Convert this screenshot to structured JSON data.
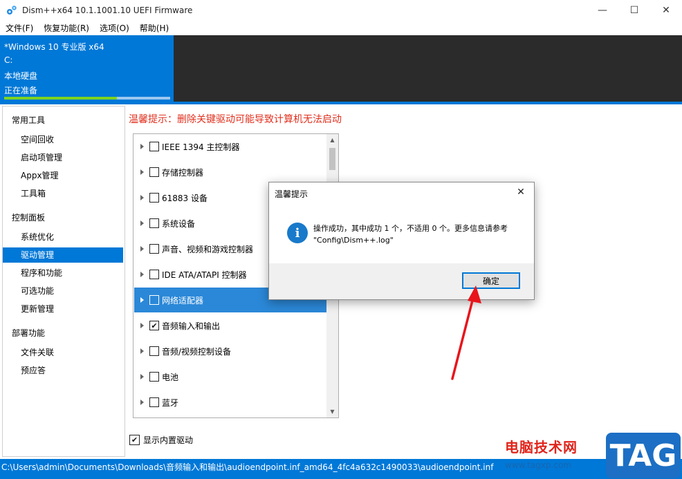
{
  "window": {
    "title": "Dism++x64 10.1.1001.10 UEFI Firmware",
    "minimize_glyph": "—",
    "maximize_glyph": "☐",
    "close_glyph": "✕"
  },
  "menu": [
    {
      "label": "文件(F)"
    },
    {
      "label": "恢复功能(R)"
    },
    {
      "label": "选项(O)"
    },
    {
      "label": "帮助(H)"
    }
  ],
  "header": {
    "os_name": "*Windows 10 专业版 x64",
    "drive": "C:",
    "disk_type": "本地硬盘",
    "status": "正在准备",
    "progress": 0.68,
    "colors": {
      "accent": "#0078d7",
      "progress": "#7ed321",
      "dark": "#2b2b2b"
    }
  },
  "sidebar": {
    "groups": [
      {
        "title": "常用工具",
        "items": [
          "空间回收",
          "启动项管理",
          "Appx管理",
          "工具箱"
        ]
      },
      {
        "title": "控制面板",
        "items": [
          "系统优化",
          "驱动管理",
          "程序和功能",
          "可选功能",
          "更新管理"
        ]
      },
      {
        "title": "部署功能",
        "items": [
          "文件关联",
          "预应答"
        ]
      }
    ],
    "selected": "驱动管理"
  },
  "main": {
    "warning": "温馨提示：删除关键驱动可能导致计算机无法启动",
    "warning_color": "#e0301e",
    "drivers": [
      {
        "label": "IEEE 1394 主控制器",
        "checked": false
      },
      {
        "label": "存储控制器",
        "checked": false
      },
      {
        "label": "61883 设备",
        "checked": false
      },
      {
        "label": "系统设备",
        "checked": false
      },
      {
        "label": "声音、视频和游戏控制器",
        "checked": false
      },
      {
        "label": "IDE ATA/ATAPI 控制器",
        "checked": false
      },
      {
        "label": "网络适配器",
        "checked": false,
        "selected": true
      },
      {
        "label": "音频输入和输出",
        "checked": true
      },
      {
        "label": "音频/视频控制设备",
        "checked": false
      },
      {
        "label": "电池",
        "checked": false
      },
      {
        "label": "蓝牙",
        "checked": false
      }
    ],
    "show_builtin_label": "显示内置驱动",
    "show_builtin_checked": true,
    "check_glyph": "✔"
  },
  "statusbar": {
    "path": "C:\\Users\\admin\\Documents\\Downloads\\音频输入和输出\\audioendpoint.inf_amd64_4fc4a632c1490033\\audioendpoint.inf"
  },
  "dialog": {
    "title": "温馨提示",
    "close_glyph": "✕",
    "icon": "info-icon",
    "icon_glyph": "i",
    "message_line1": "操作成功，其中成功 1 个，不适用 0 个。更多信息请参考",
    "message_line2": "\"Config\\Dism++.log\"",
    "ok_label": "确定"
  },
  "watermark": {
    "site_name": "电脑技术网",
    "url": "www.tagxp.com",
    "tag": "TAG"
  }
}
